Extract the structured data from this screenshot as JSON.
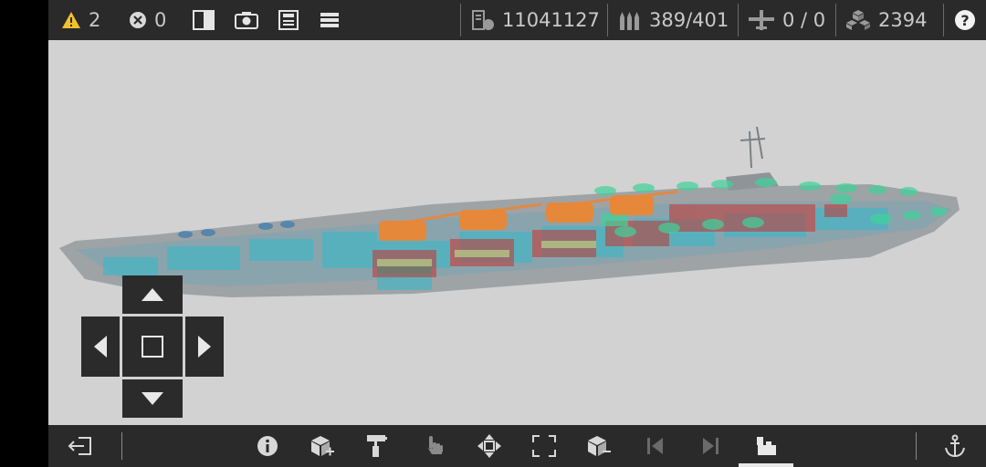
{
  "topbar": {
    "warnings": "2",
    "errors": "0",
    "cost": "11041127",
    "ammo": "389/401",
    "aircraft": "0 / 0",
    "blocks": "2394",
    "help_label": "?"
  },
  "colors": {
    "warning_yellow": "#f3c12a",
    "bar_bg": "#2a2a2a",
    "viewport_bg": "#d2d2d2",
    "hull": "#8f9699",
    "turret_orange": "#f0852e",
    "armor_teal": "#3ab8c9",
    "armor_green": "#3fd39a",
    "armor_red": "#c9332f"
  },
  "icons": {
    "warning": "warning-triangle-icon",
    "error": "error-x-circle-icon",
    "split_view": "split-view-icon",
    "camera": "camera-icon",
    "save": "save-icon",
    "menu": "menu-icon",
    "cost": "cost-icon",
    "ammo": "ammo-icon",
    "aircraft": "aircraft-icon",
    "blocks": "blocks-icon",
    "exit": "exit-icon",
    "info": "info-icon",
    "add_block": "add-block-icon",
    "paint": "paint-roller-icon",
    "touch": "touch-hand-icon",
    "move": "move-icon",
    "resize": "resize-icon",
    "remove_block": "remove-block-icon",
    "prev": "previous-icon",
    "next": "next-icon",
    "components": "components-icon",
    "anchor": "anchor-icon"
  }
}
